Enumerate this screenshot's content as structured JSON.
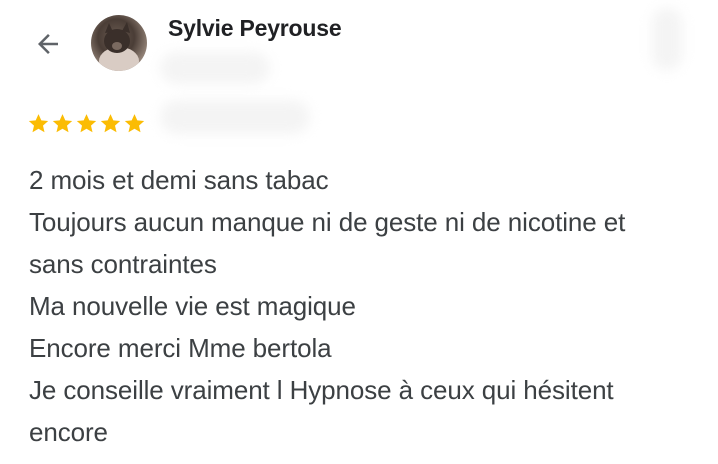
{
  "header": {
    "back_icon": "arrow-left-icon",
    "author_name": "Sylvie Peyrouse"
  },
  "rating": {
    "stars": 5,
    "max_stars": 5,
    "star_color": "#fbbc04"
  },
  "review": {
    "lines": [
      "2 mois et demi sans tabac",
      "Toujours aucun manque ni de geste ni de nicotine et",
      "sans contraintes",
      "Ma nouvelle vie est magique",
      "Encore merci Mme bertola",
      "Je conseille vraiment l Hypnose à ceux qui hésitent",
      "encore"
    ]
  },
  "colors": {
    "name_text": "#202124",
    "body_text": "#3c4043",
    "icon": "#5f6368"
  }
}
